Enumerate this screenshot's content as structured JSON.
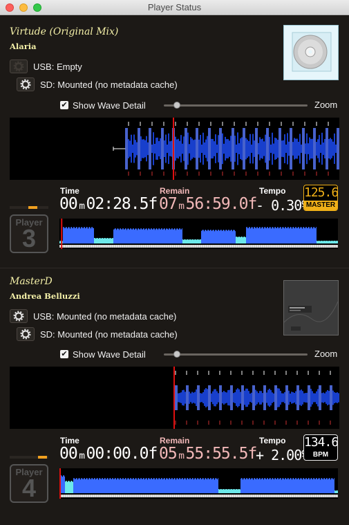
{
  "window": {
    "title": "Player Status"
  },
  "colors": {
    "track_text": "#f4f0a8",
    "wave_blue": "#1f4fff",
    "overview_blue": "#3a6bff",
    "overview_cyan": "#6ce8ea",
    "playhead_red": "#e01010",
    "remain_pink": "#f2b8b8",
    "master_orange": "#f0b018"
  },
  "players": [
    {
      "track_title": "Virtude (Original Mix)",
      "artist": "Alaria",
      "art_icon": "cd-icon",
      "usb_label": "USB: Empty",
      "sd_label": "SD: Mounted (no metadata cache)",
      "wave_detail_label": "Show Wave Detail",
      "wave_detail_checked": true,
      "zoom_label": "Zoom",
      "zoom_level": 0.09,
      "player_word": "Player",
      "player_number": "3",
      "time_label": "Time",
      "time_value": "00ₘ02:28.5f",
      "remain_label": "Remain",
      "remain_value": "07ₘ56:59.0f",
      "tempo_label": "Tempo",
      "tempo_value": "- 0.30%",
      "bpm_value": "125.6",
      "bpm_tag": "MASTER",
      "is_master": true,
      "played_fraction": 0.008
    },
    {
      "track_title": "MasterD",
      "artist": "Andrea Belluzzi",
      "art_icon": "album-art-icon",
      "usb_label": "USB: Mounted (no metadata cache)",
      "sd_label": "SD: Mounted (no metadata cache)",
      "wave_detail_label": "Show Wave Detail",
      "wave_detail_checked": true,
      "zoom_label": "Zoom",
      "zoom_level": 0.09,
      "player_word": "Player",
      "player_number": "4",
      "time_label": "Time",
      "time_value": "00ₘ00:00.0f",
      "remain_label": "Remain",
      "remain_value": "05ₘ55:55.5f",
      "tempo_label": "Tempo",
      "tempo_value": "+ 2.00%",
      "bpm_value": "134.6",
      "bpm_tag": "BPM",
      "is_master": false,
      "played_fraction": 0.0
    }
  ]
}
